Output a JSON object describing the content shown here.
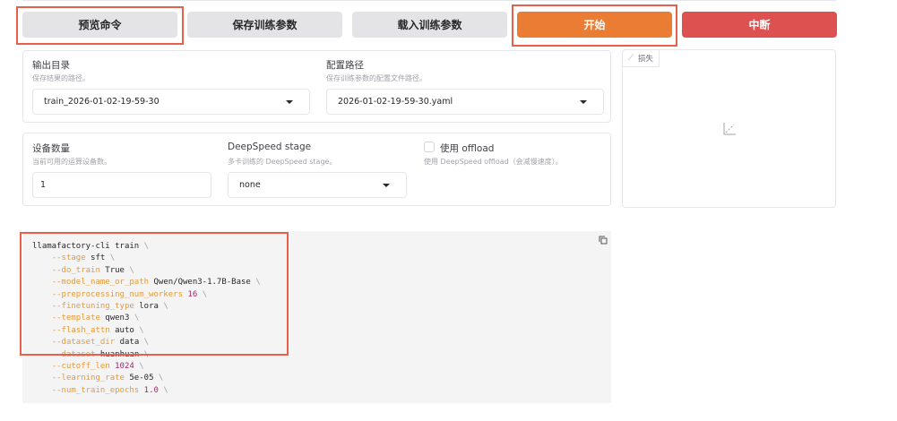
{
  "buttons": {
    "preview": "预览命令",
    "save": "保存训练参数",
    "load": "载入训练参数",
    "start": "开始",
    "abort": "中断"
  },
  "output_dir": {
    "label": "输出目录",
    "info": "保存结果的路径。",
    "value": "train_2026-01-02-19-59-30"
  },
  "config_path": {
    "label": "配置路径",
    "info": "保存训练参数的配置文件路径。",
    "value": "2026-01-02-19-59-30.yaml"
  },
  "device_count": {
    "label": "设备数量",
    "info": "当前可用的运算设备数。",
    "value": "1"
  },
  "ds_stage": {
    "label": "DeepSpeed stage",
    "info": "多卡训练的 DeepSpeed stage。",
    "value": "none"
  },
  "ds_offload": {
    "label": "使用 offload",
    "info": "使用 DeepSpeed offload（会减慢速度）。",
    "checked": false
  },
  "loss_plot": {
    "label": "损失"
  },
  "command": {
    "first": "llamafactory-cli train",
    "args": [
      {
        "key": "--stage",
        "value": "sft",
        "num": false
      },
      {
        "key": "--do_train",
        "value": "True",
        "num": false
      },
      {
        "key": "--model_name_or_path",
        "value": "Qwen/Qwen3-1.7B-Base",
        "num": false
      },
      {
        "key": "--preprocessing_num_workers",
        "value": "16",
        "num": true
      },
      {
        "key": "--finetuning_type",
        "value": "lora",
        "num": false
      },
      {
        "key": "--template",
        "value": "qwen3",
        "num": false
      },
      {
        "key": "--flash_attn",
        "value": "auto",
        "num": false
      },
      {
        "key": "--dataset_dir",
        "value": "data",
        "num": false
      },
      {
        "key": "--dataset",
        "value": "huanhuan",
        "num": false
      },
      {
        "key": "--cutoff_len",
        "value": "1024",
        "num": true
      },
      {
        "key": "--learning_rate",
        "value": "5e-05",
        "num": false
      },
      {
        "key": "--num_train_epochs",
        "value": "1.0",
        "num": true
      }
    ]
  }
}
